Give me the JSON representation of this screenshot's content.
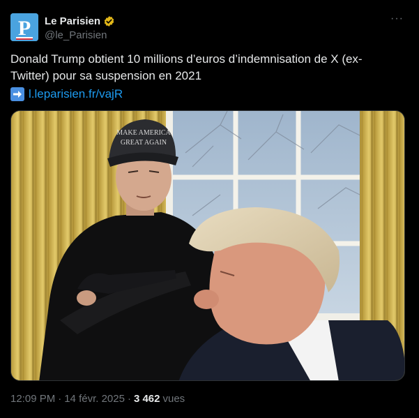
{
  "author": {
    "display_name": "Le Parisien",
    "handle": "@le_Parisien",
    "avatar_letter": "P",
    "verified_badge": "gold-verified-icon",
    "brand_color": "#4aa3df"
  },
  "tweet": {
    "text": "Donald Trump obtient 10 millions d’euros d’indemnisation de X (ex-Twitter) pour sa suspension en 2021",
    "link_text": "l.leparisien.fr/vajR",
    "link_icon": "right-arrow-emoji-icon",
    "media": {
      "hat_text_line1": "MAKE AMERICA",
      "hat_text_line2": "GREAT AGAIN"
    }
  },
  "meta": {
    "time": "12:09 PM",
    "separator": "·",
    "date": "14 févr. 2025",
    "views_count": "3 462",
    "views_label": "vues"
  },
  "more_menu": {
    "label": "···"
  },
  "colors": {
    "background": "#000000",
    "text": "#e7e9ea",
    "muted": "#71767b",
    "link": "#1d9bf0"
  }
}
